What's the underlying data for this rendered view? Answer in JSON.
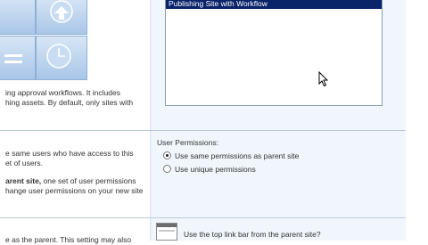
{
  "template_list": {
    "selected_item": "Publishing Site with Workflow"
  },
  "template_description": {
    "line1": "ing approval workflows. It includes",
    "line2": "hing assets. By default, only sites with"
  },
  "permissions_description": {
    "line1": "e same users who have access to this",
    "line2": "et of users.",
    "line3_bold": "arent site,",
    "line3_rest": " one set of user permissions",
    "line4": "hange user permissions on your new site"
  },
  "user_permissions": {
    "heading": "User Permissions:",
    "options": [
      {
        "label": "Use same permissions as parent site",
        "selected": true
      },
      {
        "label": "Use unique permissions",
        "selected": false
      }
    ]
  },
  "navigation": {
    "description": "e as the parent. This setting may also",
    "question": "Use the top link bar from the parent site?"
  }
}
